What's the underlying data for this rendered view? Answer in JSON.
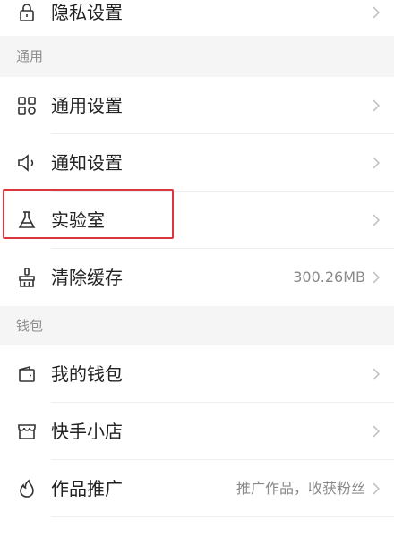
{
  "top_item": {
    "label": "隐私设置",
    "icon": "lock-icon"
  },
  "general_section": {
    "title": "通用",
    "items": [
      {
        "label": "通用设置",
        "icon": "grid-icon"
      },
      {
        "label": "通知设置",
        "icon": "speaker-icon"
      },
      {
        "label": "实验室",
        "icon": "flask-icon"
      },
      {
        "label": "清除缓存",
        "icon": "broom-icon",
        "value": "300.26MB"
      }
    ]
  },
  "wallet_section": {
    "title": "钱包",
    "items": [
      {
        "label": "我的钱包",
        "icon": "wallet-icon"
      },
      {
        "label": "快手小店",
        "icon": "shop-icon"
      },
      {
        "label": "作品推广",
        "icon": "flame-icon",
        "value": "推广作品，收获粉丝"
      }
    ]
  },
  "colors": {
    "highlight_border": "#d9363e",
    "section_bg": "#f5f5f5",
    "icon_stroke": "#333333"
  }
}
